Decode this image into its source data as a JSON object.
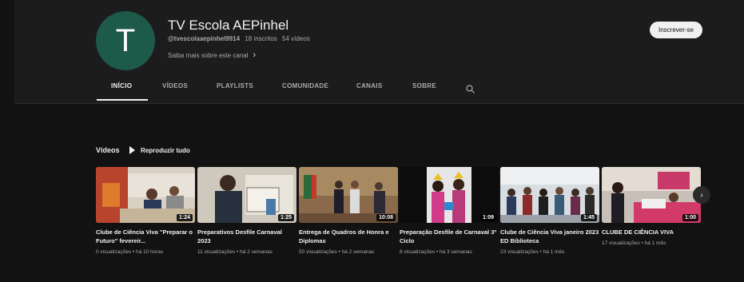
{
  "channel": {
    "avatar_letter": "T",
    "name": "TV Escola AEPinhel",
    "handle": "@tvescolaaepinhel9914",
    "subscribers": "18 inscritos",
    "video_count": "54 vídeos",
    "about_link": "Saiba mais sobre este canal",
    "subscribe_label": "Inscrever-se",
    "colors": {
      "avatar_bg": "#1d5a4a",
      "page_bg": "#121212"
    }
  },
  "tabs": [
    {
      "label": "INÍCIO",
      "active": true
    },
    {
      "label": "VÍDEOS"
    },
    {
      "label": "PLAYLISTS"
    },
    {
      "label": "COMUNIDADE"
    },
    {
      "label": "CANAIS"
    },
    {
      "label": "SOBRE"
    }
  ],
  "shelf": {
    "title": "Vídeos",
    "play_all": "Reproduzir tudo",
    "next_icon": "chevron-right-icon"
  },
  "videos": [
    {
      "title": "Clube de Ciência Viva \"Preparar o Futuro\" fevereir...",
      "meta": "0 visualizações • há 10 horas",
      "duration": "1:24"
    },
    {
      "title": "Preparativos Desfile Carnaval 2023",
      "meta": "11 visualizações • há 2 semanas",
      "duration": "1:25"
    },
    {
      "title": "Entrega de Quadros de Honra e Diplomas",
      "meta": "50 visualizações • há 2 semanas",
      "duration": "10:08"
    },
    {
      "title": "Preparação Desfile de Carnaval 3º Ciclo",
      "meta": "8 visualizações • há 3 semanas",
      "duration": "1:09"
    },
    {
      "title": "Clube de Ciência Viva janeiro 2023 ED Biblioteca",
      "meta": "23 visualizações • há 1 mês",
      "duration": "1:45"
    },
    {
      "title": "CLUBE DE CIÊNCIA VIVA",
      "meta": "17 visualizações • há 1 mês",
      "duration": "1:00"
    }
  ]
}
